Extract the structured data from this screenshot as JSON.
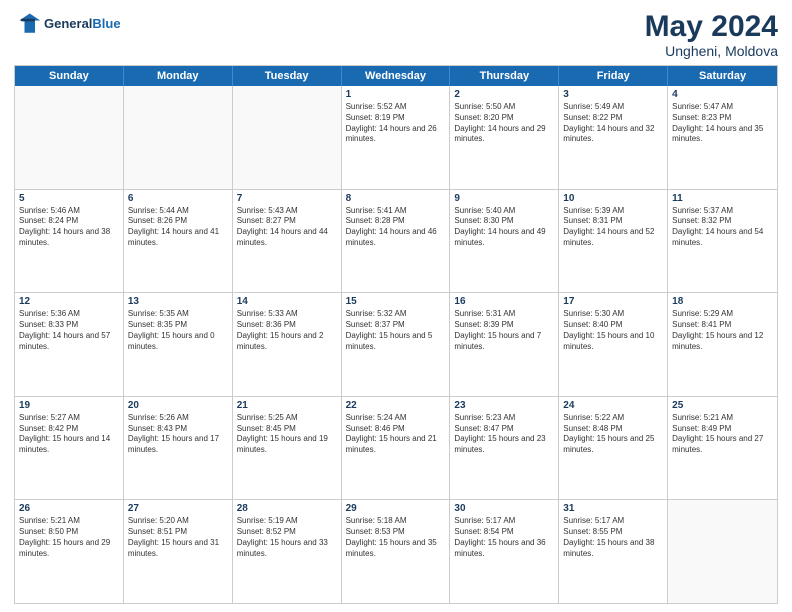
{
  "logo": {
    "line1": "General",
    "line2": "Blue"
  },
  "title": {
    "month_year": "May 2024",
    "location": "Ungheni, Moldova"
  },
  "days_of_week": [
    "Sunday",
    "Monday",
    "Tuesday",
    "Wednesday",
    "Thursday",
    "Friday",
    "Saturday"
  ],
  "weeks": [
    [
      {
        "day": "",
        "info": ""
      },
      {
        "day": "",
        "info": ""
      },
      {
        "day": "",
        "info": ""
      },
      {
        "day": "1",
        "info": "Sunrise: 5:52 AM\nSunset: 8:19 PM\nDaylight: 14 hours and 26 minutes."
      },
      {
        "day": "2",
        "info": "Sunrise: 5:50 AM\nSunset: 8:20 PM\nDaylight: 14 hours and 29 minutes."
      },
      {
        "day": "3",
        "info": "Sunrise: 5:49 AM\nSunset: 8:22 PM\nDaylight: 14 hours and 32 minutes."
      },
      {
        "day": "4",
        "info": "Sunrise: 5:47 AM\nSunset: 8:23 PM\nDaylight: 14 hours and 35 minutes."
      }
    ],
    [
      {
        "day": "5",
        "info": "Sunrise: 5:46 AM\nSunset: 8:24 PM\nDaylight: 14 hours and 38 minutes."
      },
      {
        "day": "6",
        "info": "Sunrise: 5:44 AM\nSunset: 8:26 PM\nDaylight: 14 hours and 41 minutes."
      },
      {
        "day": "7",
        "info": "Sunrise: 5:43 AM\nSunset: 8:27 PM\nDaylight: 14 hours and 44 minutes."
      },
      {
        "day": "8",
        "info": "Sunrise: 5:41 AM\nSunset: 8:28 PM\nDaylight: 14 hours and 46 minutes."
      },
      {
        "day": "9",
        "info": "Sunrise: 5:40 AM\nSunset: 8:30 PM\nDaylight: 14 hours and 49 minutes."
      },
      {
        "day": "10",
        "info": "Sunrise: 5:39 AM\nSunset: 8:31 PM\nDaylight: 14 hours and 52 minutes."
      },
      {
        "day": "11",
        "info": "Sunrise: 5:37 AM\nSunset: 8:32 PM\nDaylight: 14 hours and 54 minutes."
      }
    ],
    [
      {
        "day": "12",
        "info": "Sunrise: 5:36 AM\nSunset: 8:33 PM\nDaylight: 14 hours and 57 minutes."
      },
      {
        "day": "13",
        "info": "Sunrise: 5:35 AM\nSunset: 8:35 PM\nDaylight: 15 hours and 0 minutes."
      },
      {
        "day": "14",
        "info": "Sunrise: 5:33 AM\nSunset: 8:36 PM\nDaylight: 15 hours and 2 minutes."
      },
      {
        "day": "15",
        "info": "Sunrise: 5:32 AM\nSunset: 8:37 PM\nDaylight: 15 hours and 5 minutes."
      },
      {
        "day": "16",
        "info": "Sunrise: 5:31 AM\nSunset: 8:39 PM\nDaylight: 15 hours and 7 minutes."
      },
      {
        "day": "17",
        "info": "Sunrise: 5:30 AM\nSunset: 8:40 PM\nDaylight: 15 hours and 10 minutes."
      },
      {
        "day": "18",
        "info": "Sunrise: 5:29 AM\nSunset: 8:41 PM\nDaylight: 15 hours and 12 minutes."
      }
    ],
    [
      {
        "day": "19",
        "info": "Sunrise: 5:27 AM\nSunset: 8:42 PM\nDaylight: 15 hours and 14 minutes."
      },
      {
        "day": "20",
        "info": "Sunrise: 5:26 AM\nSunset: 8:43 PM\nDaylight: 15 hours and 17 minutes."
      },
      {
        "day": "21",
        "info": "Sunrise: 5:25 AM\nSunset: 8:45 PM\nDaylight: 15 hours and 19 minutes."
      },
      {
        "day": "22",
        "info": "Sunrise: 5:24 AM\nSunset: 8:46 PM\nDaylight: 15 hours and 21 minutes."
      },
      {
        "day": "23",
        "info": "Sunrise: 5:23 AM\nSunset: 8:47 PM\nDaylight: 15 hours and 23 minutes."
      },
      {
        "day": "24",
        "info": "Sunrise: 5:22 AM\nSunset: 8:48 PM\nDaylight: 15 hours and 25 minutes."
      },
      {
        "day": "25",
        "info": "Sunrise: 5:21 AM\nSunset: 8:49 PM\nDaylight: 15 hours and 27 minutes."
      }
    ],
    [
      {
        "day": "26",
        "info": "Sunrise: 5:21 AM\nSunset: 8:50 PM\nDaylight: 15 hours and 29 minutes."
      },
      {
        "day": "27",
        "info": "Sunrise: 5:20 AM\nSunset: 8:51 PM\nDaylight: 15 hours and 31 minutes."
      },
      {
        "day": "28",
        "info": "Sunrise: 5:19 AM\nSunset: 8:52 PM\nDaylight: 15 hours and 33 minutes."
      },
      {
        "day": "29",
        "info": "Sunrise: 5:18 AM\nSunset: 8:53 PM\nDaylight: 15 hours and 35 minutes."
      },
      {
        "day": "30",
        "info": "Sunrise: 5:17 AM\nSunset: 8:54 PM\nDaylight: 15 hours and 36 minutes."
      },
      {
        "day": "31",
        "info": "Sunrise: 5:17 AM\nSunset: 8:55 PM\nDaylight: 15 hours and 38 minutes."
      },
      {
        "day": "",
        "info": ""
      }
    ]
  ]
}
